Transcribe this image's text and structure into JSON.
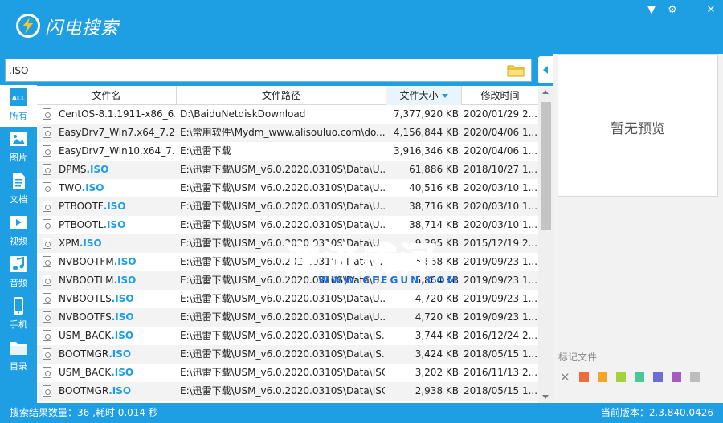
{
  "app": {
    "title": "闪电搜索"
  },
  "window_controls": [
    {
      "name": "dropdown-icon",
      "glyph": "▼"
    },
    {
      "name": "settings-icon",
      "glyph": "⚙"
    },
    {
      "name": "minimize-icon",
      "glyph": "—"
    },
    {
      "name": "close-icon",
      "glyph": "✕"
    }
  ],
  "search": {
    "value": ".ISO"
  },
  "categories": [
    {
      "id": "all",
      "label": "所有",
      "icon": "all-icon",
      "active": true
    },
    {
      "id": "image",
      "label": "图片",
      "icon": "image-icon",
      "active": false
    },
    {
      "id": "doc",
      "label": "文档",
      "icon": "document-icon",
      "active": false
    },
    {
      "id": "video",
      "label": "视频",
      "icon": "video-icon",
      "active": false
    },
    {
      "id": "audio",
      "label": "音频",
      "icon": "music-icon",
      "active": false
    },
    {
      "id": "phone",
      "label": "手机",
      "icon": "phone-icon",
      "active": false
    },
    {
      "id": "folder",
      "label": "目录",
      "icon": "folder-icon",
      "active": false
    }
  ],
  "table": {
    "columns": {
      "name": "文件名",
      "path": "文件路径",
      "size": "文件大小",
      "date": "修改时间"
    },
    "rows": [
      {
        "name": "CentOS-8.1.1911-x86_6...",
        "hl": "",
        "path": "D:\\BaiduNetdiskDownload",
        "size": "7,377,920 KB",
        "date": "2020/01/29 2..."
      },
      {
        "name": "EasyDrv7_Win7.x64_7.2...",
        "hl": "",
        "path": "E:\\常用软件\\Mydm_www.alisouluo.com\\do...",
        "size": "4,156,844 KB",
        "date": "2020/04/06 1..."
      },
      {
        "name": "EasyDrv7_Win10.x64_7....",
        "hl": "",
        "path": "E:\\迅雷下载",
        "size": "3,916,346 KB",
        "date": "2020/04/06 1..."
      },
      {
        "name": "DPMS",
        "hl": ".ISO",
        "path": "E:\\迅雷下载\\USM_v6.0.2020.0310S\\Data\\U...",
        "size": "61,886 KB",
        "date": "2018/10/27 1..."
      },
      {
        "name": "TWO",
        "hl": ".ISO",
        "path": "E:\\迅雷下载\\USM_v6.0.2020.0310S\\Data\\U...",
        "size": "40,516 KB",
        "date": "2020/03/10 1..."
      },
      {
        "name": "PTBOOTF",
        "hl": ".ISO",
        "path": "E:\\迅雷下载\\USM_v6.0.2020.0310S\\Data\\U...",
        "size": "38,716 KB",
        "date": "2020/03/10 1..."
      },
      {
        "name": "PTBOOTL",
        "hl": ".ISO",
        "path": "E:\\迅雷下载\\USM_v6.0.2020.0310S\\Data\\U...",
        "size": "38,714 KB",
        "date": "2020/03/10 1..."
      },
      {
        "name": "XPM",
        "hl": ".ISO",
        "path": "E:\\迅雷下载\\USM_v6.0.2020.0310S\\Data\\U...",
        "size": "9,395 KB",
        "date": "2015/12/19 2..."
      },
      {
        "name": "NVBOOTFM",
        "hl": ".ISO",
        "path": "E:\\迅雷下载\\USM_v6.0.2020.0310S\\Data\\U...",
        "size": "5,868 KB",
        "date": "2019/09/23 1..."
      },
      {
        "name": "NVBOOTLM",
        "hl": ".ISO",
        "path": "E:\\迅雷下载\\USM_v6.0.2020.0310S\\Data\\U...",
        "size": "5,864 KB",
        "date": "2019/09/23 1..."
      },
      {
        "name": "NVBOOTLS",
        "hl": ".ISO",
        "path": "E:\\迅雷下载\\USM_v6.0.2020.0310S\\Data\\U...",
        "size": "4,720 KB",
        "date": "2019/09/23 1..."
      },
      {
        "name": "NVBOOTFS",
        "hl": ".ISO",
        "path": "E:\\迅雷下载\\USM_v6.0.2020.0310S\\Data\\U...",
        "size": "4,720 KB",
        "date": "2019/09/23 1..."
      },
      {
        "name": "USM_BACK",
        "hl": ".ISO",
        "path": "E:\\迅雷下载\\USM_v6.0.2020.0310S\\Data\\IS...",
        "size": "3,744 KB",
        "date": "2016/12/24 2..."
      },
      {
        "name": "BOOTMGR",
        "hl": ".ISO",
        "path": "E:\\迅雷下载\\USM_v6.0.2020.0310S\\Data\\IS...",
        "size": "3,424 KB",
        "date": "2018/05/15 1..."
      },
      {
        "name": "USM_BACK",
        "hl": ".ISO",
        "path": "E:\\迅雷下载\\USM_v6.0.2020.0310S\\Data\\ISO",
        "size": "3,202 KB",
        "date": "2016/11/13 2..."
      },
      {
        "name": "BOOTMGR",
        "hl": ".ISO",
        "path": "E:\\迅雷下载\\USM_v6.0.2020.0310S\\Data\\ISO",
        "size": "2,938 KB",
        "date": "2018/05/15 1..."
      }
    ]
  },
  "preview": {
    "empty_text": "暂无预览"
  },
  "marks": {
    "label": "标记文件",
    "clear_glyph": "✕",
    "colors": [
      "#ee6b3c",
      "#f7a52a",
      "#a6d13b",
      "#46c89a",
      "#6a6fd6",
      "#a65bc2",
      "#bdbdbd"
    ]
  },
  "status": {
    "left": "搜索结果数量：36 ,耗时 0.014 秒",
    "right": "当前版本：2.3.840.0426"
  },
  "watermark": {
    "text": "逆流成河",
    "sub": "WWW.CFEGUN.COM"
  }
}
